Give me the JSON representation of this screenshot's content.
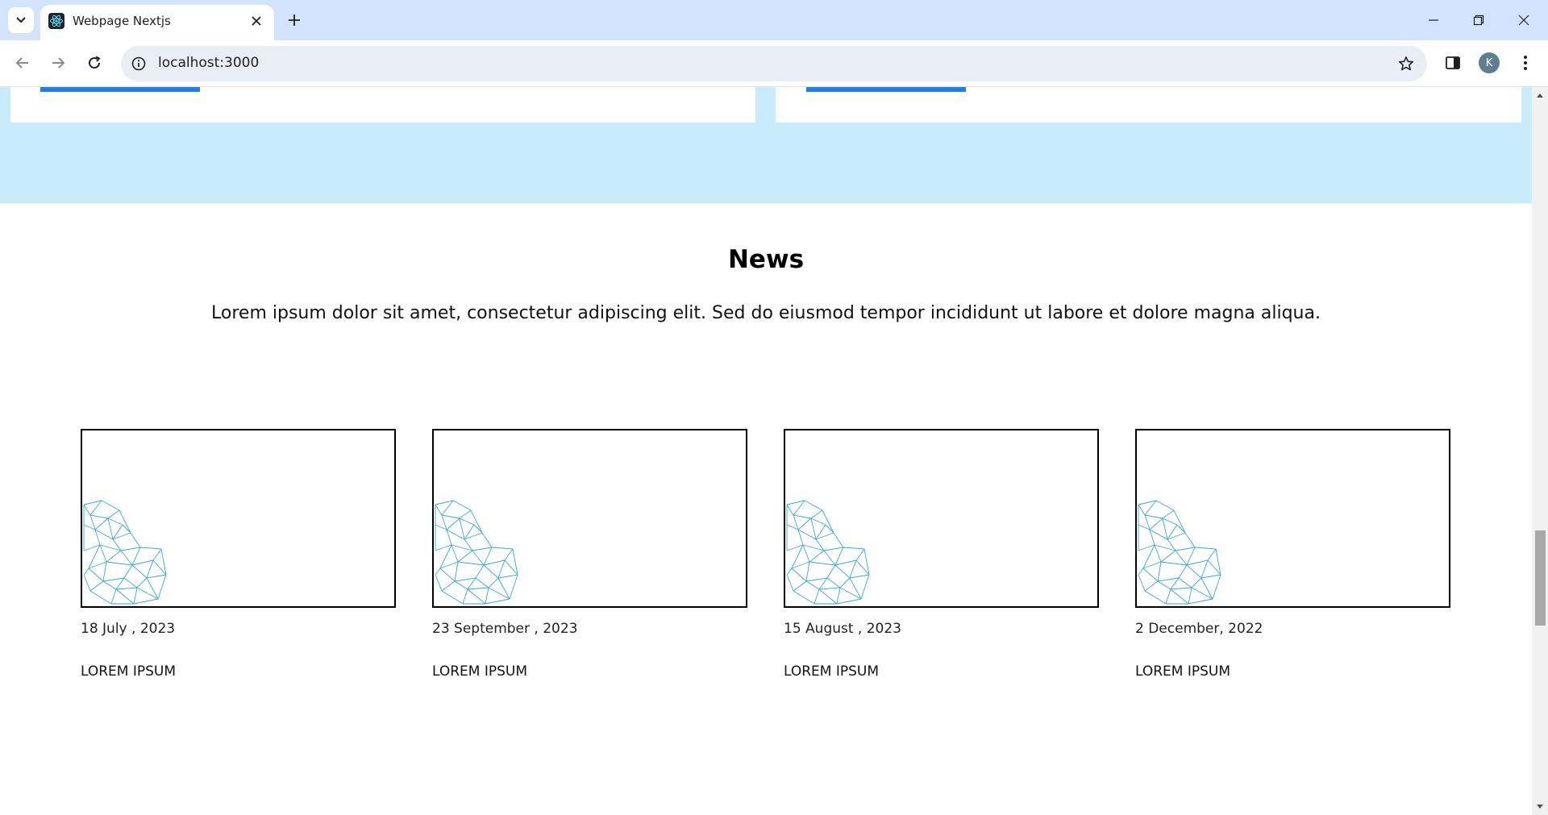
{
  "browser": {
    "tab_title": "Webpage Nextjs",
    "url": "localhost:3000",
    "profile_initial": "K"
  },
  "news": {
    "title": "News",
    "lead": "Lorem ipsum dolor sit amet, consectetur adipiscing elit. Sed do eiusmod tempor incididunt ut labore et dolore magna aliqua.",
    "items": [
      {
        "date": "18 July , 2023",
        "heading": "LOREM IPSUM"
      },
      {
        "date": "23 September , 2023",
        "heading": "LOREM IPSUM"
      },
      {
        "date": "15 August , 2023",
        "heading": "LOREM IPSUM"
      },
      {
        "date": "2 December, 2022",
        "heading": "LOREM IPSUM"
      }
    ]
  },
  "colors": {
    "tabstrip": "#d3e3fd",
    "hero_band": "#c9ecfd",
    "accent": "#1f7fe6",
    "mesh_line": "#3aa6e0"
  }
}
